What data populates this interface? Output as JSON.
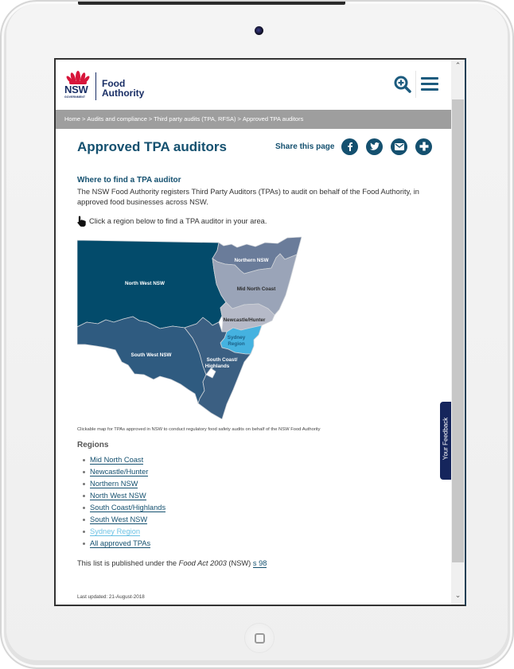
{
  "header": {
    "logo": {
      "government": "NSW",
      "government_sub": "GOVERNMENT",
      "agency_line1": "Food",
      "agency_line2": "Authority"
    },
    "search_icon": "search-plus-icon",
    "menu_icon": "hamburger-menu-icon"
  },
  "breadcrumb": [
    {
      "label": "Home"
    },
    {
      "label": "Audits and compliance"
    },
    {
      "label": "Third party audits (TPA, RFSA)"
    },
    {
      "label": "Approved TPA auditors"
    }
  ],
  "breadcrumb_separator": ">",
  "page_title": "Approved TPA auditors",
  "share": {
    "label": "Share this page",
    "buttons": [
      {
        "name": "facebook",
        "icon": "facebook-icon"
      },
      {
        "name": "twitter",
        "icon": "twitter-icon"
      },
      {
        "name": "email",
        "icon": "email-icon"
      },
      {
        "name": "more",
        "icon": "plus-icon"
      }
    ]
  },
  "content": {
    "section_heading": "Where to find a TPA auditor",
    "intro": "The NSW Food Authority registers Third Party Auditors (TPAs) to audit on behalf of the Food Authority, in approved food businesses across NSW.",
    "hint": "Click a region below to find a TPA auditor in your area.",
    "hint_icon": "pointing-hand-icon",
    "map_caption": "Clickable map for TPAs approved in NSW to conduct regulatory food safety audits on behalf of the NSW Food Authority",
    "regions_heading": "Regions",
    "published_prefix": "This list is published under the ",
    "published_act": "Food Act 2003",
    "published_middle": " (NSW) ",
    "published_link": "s 98",
    "last_updated": "Last updated: 21-August-2018"
  },
  "map": {
    "regions": [
      {
        "id": "north-west",
        "label": "North West NSW",
        "color": "#034b6b",
        "text_color": "#ffffff"
      },
      {
        "id": "northern",
        "label": "Northern NSW",
        "color": "#6a7c9a",
        "text_color": "#ffffff"
      },
      {
        "id": "mid-north-coast",
        "label": "Mid North Coast",
        "color": "#9aa4b8",
        "text_color": "#2b2b2b"
      },
      {
        "id": "newcastle-hunter",
        "label": "Newcastle/Hunter",
        "color": "#b6bac8",
        "text_color": "#2b2b2b"
      },
      {
        "id": "sydney",
        "label_line1": "Sydney",
        "label_line2": "Region",
        "color": "#45b2e0",
        "text_color": "#1b5f86"
      },
      {
        "id": "south-west",
        "label": "South West NSW",
        "color": "#2f5b80",
        "text_color": "#ffffff"
      },
      {
        "id": "south-coast",
        "label_line1": "South Coast/",
        "label_line2": "Highlands",
        "color": "#3b5f82",
        "text_color": "#ffffff"
      }
    ]
  },
  "region_links": [
    {
      "label": "Mid North Coast",
      "visited": false
    },
    {
      "label": "Newcastle/Hunter",
      "visited": false
    },
    {
      "label": "Northern NSW",
      "visited": false
    },
    {
      "label": "North West NSW",
      "visited": false
    },
    {
      "label": "South Coast/Highlands",
      "visited": false
    },
    {
      "label": "South West NSW",
      "visited": false
    },
    {
      "label": "Sydney Region",
      "visited": true
    },
    {
      "label": "All approved TPAs",
      "visited": false
    }
  ],
  "feedback_tab": "Your Feedback",
  "colors": {
    "brand_blue": "#14506f",
    "breadcrumb_bg": "#9e9e9e",
    "feedback_bg": "#15255c",
    "visited_link": "#6cc2e4"
  }
}
